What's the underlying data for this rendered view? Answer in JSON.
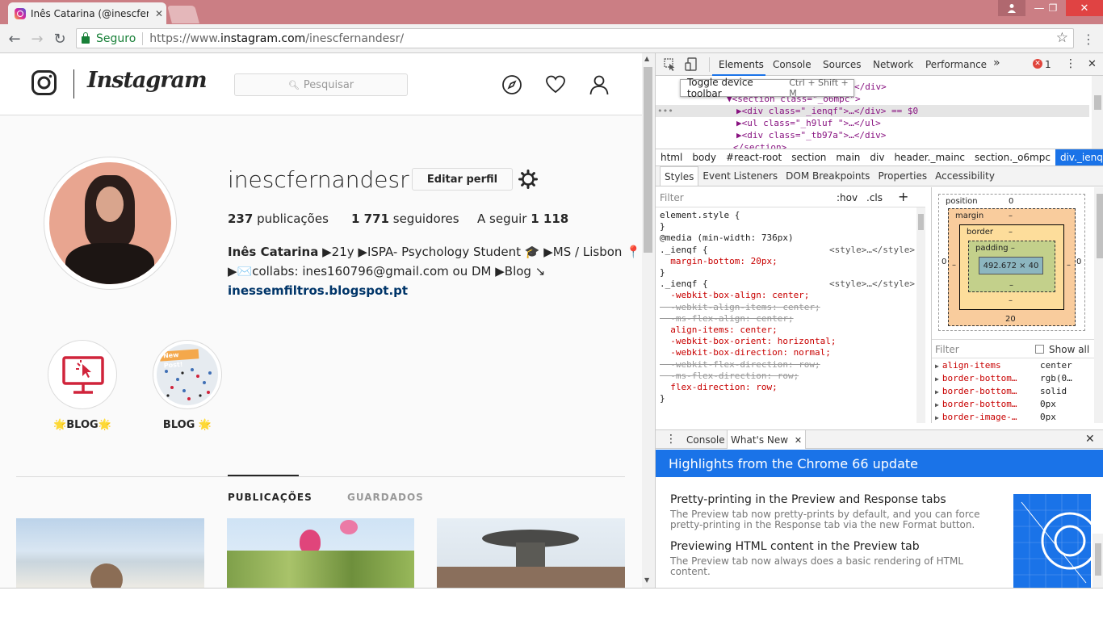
{
  "browser": {
    "tab_title": "Inês Catarina (@inescferr",
    "security_label": "Seguro",
    "url_prefix": "https://www.",
    "url_domain": "instagram.com",
    "url_path": "/inescfernandesr/"
  },
  "instagram": {
    "wordmark": "Instagram",
    "search_placeholder": "Pesquisar",
    "username": "inescfernandesr",
    "edit_profile_label": "Editar perfil",
    "stats": {
      "posts_count": "237",
      "posts_label": "publicações",
      "followers_count": "1 771",
      "followers_label": "seguidores",
      "following_label": "A seguir",
      "following_count": "1 118"
    },
    "bio": {
      "full_name": "Inês Catarina",
      "line1_rest": "▶21y ▶ISPA- Psychology Student 🎓 ▶MS / Lisbon 📍",
      "line2": "▶✉️collabs: ines160796@gmail.com ou DM ▶Blog ↘",
      "link": "inessemfiltros.blogspot.pt"
    },
    "highlights": [
      {
        "label": "🌟BLOG🌟"
      },
      {
        "label": "BLOG 🌟"
      }
    ],
    "highlight2_badge": "New Post!",
    "tabs": {
      "posts": "PUBLICAÇÕES",
      "saved": "GUARDADOS"
    }
  },
  "devtools": {
    "tabs": [
      "Elements",
      "Console",
      "Sources",
      "Network",
      "Performance"
    ],
    "more_tabs": "»",
    "error_count": "1",
    "tooltip_label": "Toggle device toolbar",
    "tooltip_shortcut": "Ctrl + Shift + M",
    "dom_lines": [
      "</div>",
      "▼<section class=\"_o6mpc\">",
      "▶<div class=\"_ienqf\">…</div> == $0",
      "▶<ul class=\"_h9luf \">…</ul>",
      "▶<div class=\"_tb97a\">…</div>",
      "</section>"
    ],
    "breadcrumbs": [
      "html",
      "body",
      "#react-root",
      "section",
      "main",
      "div",
      "header._mainc",
      "section._o6mpc",
      "div._ienqf"
    ],
    "subtabs": [
      "Styles",
      "Event Listeners",
      "DOM Breakpoints",
      "Properties",
      "Accessibility"
    ],
    "styles_filter": "Filter",
    "styles_hov": ":hov",
    "styles_cls": ".cls",
    "style_rules": [
      {
        "t": "element.style {",
        "c": "sel"
      },
      {
        "t": "}",
        "c": "sel"
      },
      {
        "t": "@media (min-width: 736px)",
        "c": "sel"
      },
      {
        "t": "._ienqf {",
        "c": "sel",
        "src": "<style>…</style>"
      },
      {
        "t": "  margin-bottom: 20px;",
        "c": "prop"
      },
      {
        "t": "}",
        "c": "sel"
      },
      {
        "t": "._ienqf {",
        "c": "sel",
        "src": "<style>…</style>"
      },
      {
        "t": "  -webkit-box-align: center;",
        "c": "prop"
      },
      {
        "t": "  -webkit-align-items: center;",
        "c": "strike"
      },
      {
        "t": "  -ms-flex-align: center;",
        "c": "strike"
      },
      {
        "t": "  align-items: center;",
        "c": "prop"
      },
      {
        "t": "  -webkit-box-orient: horizontal;",
        "c": "prop"
      },
      {
        "t": "  -webkit-box-direction: normal;",
        "c": "prop"
      },
      {
        "t": "  -webkit-flex-direction: row;",
        "c": "strike"
      },
      {
        "t": "  -ms-flex-direction: row;",
        "c": "strike"
      },
      {
        "t": "  flex-direction: row;",
        "c": "prop"
      },
      {
        "t": "}",
        "c": "sel"
      }
    ],
    "boxmodel": {
      "position_label": "position",
      "position_val": "0",
      "margin_label": "margin",
      "margin_val": "–",
      "border_label": "border",
      "border_val": "–",
      "padding_label": "padding –",
      "content_size": "492.672 × 40",
      "side_zero": "0",
      "margin_bottom": "20"
    },
    "computed_filter": "Filter",
    "show_all": "Show all",
    "computed": [
      {
        "prop": "align-items",
        "val": "center"
      },
      {
        "prop": "border-bottom…",
        "val": "rgb(0…"
      },
      {
        "prop": "border-bottom…",
        "val": "solid"
      },
      {
        "prop": "border-bottom…",
        "val": "0px"
      },
      {
        "prop": "border-image-…",
        "val": "0px"
      }
    ],
    "drawer_tabs": {
      "console": "Console",
      "whats_new": "What's New"
    },
    "whats_new": {
      "banner": "Highlights from the Chrome 66 update",
      "items": [
        {
          "title": "Pretty-printing in the Preview and Response tabs",
          "desc": "The Preview tab now pretty-prints by default, and you can force pretty-printing in the Response tab via the new Format button."
        },
        {
          "title": "Previewing HTML content in the Preview tab",
          "desc": "The Preview tab now always does a basic rendering of HTML content."
        }
      ]
    }
  }
}
